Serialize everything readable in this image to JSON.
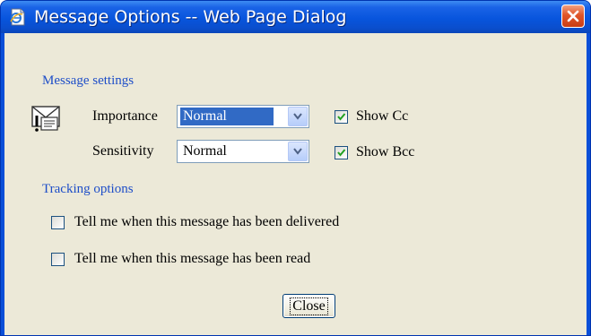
{
  "window": {
    "title": "Message Options -- Web Page Dialog",
    "app_icon": "ie-page-icon",
    "close_icon": "close-x-icon",
    "titlebar_color": "#0855dd",
    "close_color": "#e0562a"
  },
  "message_settings": {
    "heading": "Message settings",
    "icon": "message-importance-icon",
    "importance": {
      "label": "Importance",
      "value": "Normal"
    },
    "sensitivity": {
      "label": "Sensitivity",
      "value": "Normal"
    },
    "show_cc": {
      "label": "Show Cc",
      "checked": true
    },
    "show_bcc": {
      "label": "Show Bcc",
      "checked": true
    }
  },
  "tracking_options": {
    "heading": "Tracking options",
    "delivered": {
      "label": "Tell me when this message has been delivered",
      "checked": false
    },
    "read": {
      "label": "Tell me when this message has been read",
      "checked": false
    }
  },
  "buttons": {
    "close_label": "Close"
  },
  "colors": {
    "section_heading": "#1e4ec8",
    "dialog_bg": "#ece9d8",
    "selection": "#316ac5"
  }
}
